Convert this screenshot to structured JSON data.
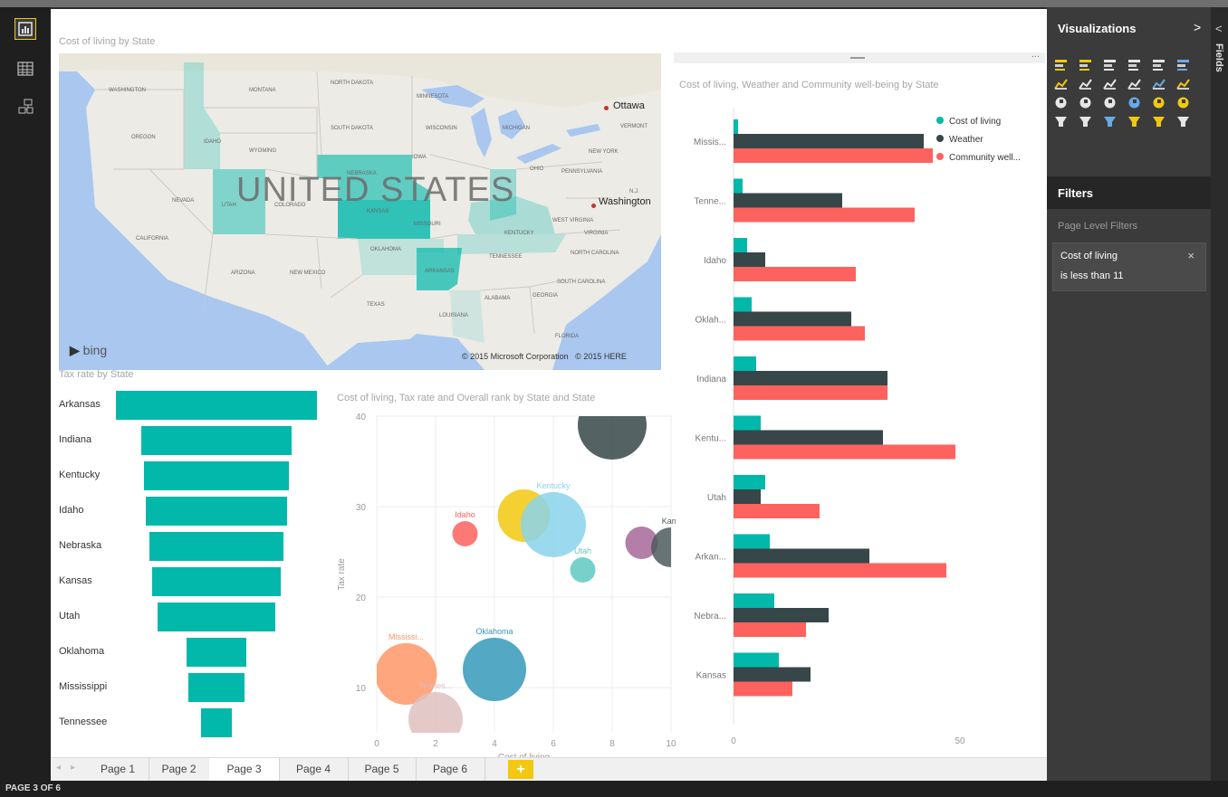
{
  "rail": {
    "items": [
      {
        "name": "report-view-icon"
      },
      {
        "name": "data-view-icon"
      },
      {
        "name": "relationships-view-icon"
      }
    ]
  },
  "map_visual": {
    "title": "Cost of living by State",
    "overlay_text": "UNITED STATES",
    "bing_label": "bing",
    "copyright": "© 2015 Microsoft Corporation   © 2015 HERE",
    "cities": [
      "Ottawa",
      "Washington"
    ],
    "state_labels": [
      {
        "text": "WASHINGTON"
      },
      {
        "text": "MONTANA"
      },
      {
        "text": "NORTH DAKOTA"
      },
      {
        "text": "MINNESOTA"
      },
      {
        "text": "OREGON"
      },
      {
        "text": "IDAHO"
      },
      {
        "text": "SOUTH DAKOTA"
      },
      {
        "text": "WISCONSIN"
      },
      {
        "text": "MICHIGAN"
      },
      {
        "text": "VERMONT"
      },
      {
        "text": "WYOMING"
      },
      {
        "text": "IOWA"
      },
      {
        "text": "NEW YORK"
      },
      {
        "text": "NEBRASKA"
      },
      {
        "text": "OHIO"
      },
      {
        "text": "PENNSYLVANIA"
      },
      {
        "text": "NEVADA"
      },
      {
        "text": "UTAH"
      },
      {
        "text": "COLORADO"
      },
      {
        "text": "KANSAS"
      },
      {
        "text": "MISSOURI"
      },
      {
        "text": "KENTUCKY"
      },
      {
        "text": "WEST VIRGINIA"
      },
      {
        "text": "VIRGINIA"
      },
      {
        "text": "CALIFORNIA"
      },
      {
        "text": "OKLAHOMA"
      },
      {
        "text": "TENNESSEE"
      },
      {
        "text": "NORTH CAROLINA"
      },
      {
        "text": "ARIZONA"
      },
      {
        "text": "NEW MEXICO"
      },
      {
        "text": "ARKANSAS"
      },
      {
        "text": "SOUTH CAROLINA"
      },
      {
        "text": "TEXAS"
      },
      {
        "text": "ALABAMA"
      },
      {
        "text": "GEORGIA"
      },
      {
        "text": "LOUISIANA"
      },
      {
        "text": "FLORIDA"
      },
      {
        "text": "N.J."
      }
    ],
    "highlight_color": "#01b8aa"
  },
  "funnel_visual": {
    "title": "Tax rate by State",
    "color": "#01b8aa"
  },
  "clustered_bar_visual": {
    "title": "Cost of living, Weather and Community well-being by State",
    "more_label": "...",
    "legend": [
      {
        "label": "Cost of living",
        "color": "#01b8aa"
      },
      {
        "label": "Weather",
        "color": "#374649"
      },
      {
        "label": "Community well...",
        "color": "#fd625e"
      }
    ]
  },
  "scatter_visual": {
    "title": "Cost of living, Tax rate and Overall rank by State and State"
  },
  "chart_data": [
    {
      "type": "bar",
      "title": "Tax rate by State",
      "categories": [
        "Arkansas",
        "Indiana",
        "Kentucky",
        "Idaho",
        "Nebraska",
        "Kansas",
        "Utah",
        "Oklahoma",
        "Mississippi",
        "Tennessee"
      ],
      "values": [
        100,
        75,
        72,
        70,
        67,
        64,
        59,
        30,
        28,
        15
      ],
      "note_type": "funnel"
    },
    {
      "type": "bar",
      "title": "Cost of living, Weather and Community well-being by State",
      "categories": [
        "Missis...",
        "Tenne...",
        "Idaho",
        "Oklah...",
        "Indiana",
        "Kentu...",
        "Utah",
        "Arkan...",
        "Nebra...",
        "Kansas"
      ],
      "series": [
        {
          "name": "Cost of living",
          "color": "#01b8aa",
          "values": [
            1,
            2,
            3,
            4,
            5,
            6,
            7,
            8,
            9,
            10
          ]
        },
        {
          "name": "Weather",
          "color": "#374649",
          "values": [
            42,
            24,
            7,
            26,
            34,
            33,
            6,
            30,
            21,
            17
          ]
        },
        {
          "name": "Community well...",
          "color": "#fd625e",
          "values": [
            44,
            40,
            27,
            29,
            34,
            49,
            19,
            47,
            16,
            13
          ]
        }
      ],
      "xlim": [
        0,
        60
      ],
      "xticks": [
        "0",
        "50"
      ],
      "orientation": "horizontal"
    },
    {
      "type": "scatter",
      "title": "Cost of living, Tax rate and Overall rank by State and State",
      "xlabel": "Cost of living",
      "ylabel": "Tax rate",
      "xlim": [
        0,
        10
      ],
      "ylim": [
        5,
        40
      ],
      "xticks": [
        "0",
        "2",
        "4",
        "6",
        "8",
        "10"
      ],
      "yticks": [
        "10",
        "20",
        "30",
        "40"
      ],
      "points": [
        {
          "label": "Mississi...",
          "x": 1,
          "y": 11.5,
          "size": 34,
          "color": "#fe9666"
        },
        {
          "label": "Tennes...",
          "x": 2,
          "y": 6.5,
          "size": 30,
          "color": "#dfbfbf"
        },
        {
          "label": "Idaho",
          "x": 3,
          "y": 27,
          "size": 14,
          "color": "#fd625e"
        },
        {
          "label": "Oklahoma",
          "x": 4,
          "y": 12,
          "size": 35,
          "color": "#3599b8"
        },
        {
          "label": "",
          "x": 5,
          "y": 29,
          "size": 29,
          "color": "#f2c80f"
        },
        {
          "label": "Kentucky",
          "x": 6,
          "y": 28,
          "size": 36,
          "color": "#8ad4eb"
        },
        {
          "label": "Utah",
          "x": 7,
          "y": 23,
          "size": 14,
          "color": "#5fc9c1"
        },
        {
          "label": "",
          "x": 8,
          "y": 39,
          "size": 38,
          "color": "#374649"
        },
        {
          "label": "",
          "x": 9,
          "y": 26,
          "size": 18,
          "color": "#a66999"
        },
        {
          "label": "Kans",
          "x": 10,
          "y": 25.5,
          "size": 22,
          "color": "#4e5a5d"
        }
      ]
    }
  ],
  "tabs": {
    "nav_left": "◂",
    "nav_right": "▸",
    "items": [
      {
        "label": "Page 1",
        "active": false
      },
      {
        "label": "Page 2",
        "active": false
      },
      {
        "label": "Page 3",
        "active": true
      },
      {
        "label": "Page 4",
        "active": false
      },
      {
        "label": "Page 5",
        "active": false
      },
      {
        "label": "Page 6",
        "active": false
      }
    ],
    "add_label": "+"
  },
  "visualizations_pane": {
    "title": "Visualizations",
    "collapse": ">",
    "icons": [
      "stacked-bar-chart-icon",
      "stacked-column-chart-icon",
      "clustered-bar-chart-icon",
      "clustered-column-chart-icon",
      "100-percent-bar-chart-icon",
      "100-percent-column-chart-icon",
      "line-chart-icon",
      "area-chart-icon",
      "line-and-column-chart-icon",
      "line-and-stacked-column-chart-icon",
      "waterfall-chart-icon",
      "scatter-chart-icon",
      "pie-chart-icon",
      "treemap-icon",
      "map-icon",
      "table-icon",
      "matrix-icon",
      "filled-map-icon",
      "funnel-icon",
      "gauge-icon",
      "card-icon",
      "multi-row-card-icon",
      "slicer-icon",
      "donut-chart-icon"
    ]
  },
  "filters_pane": {
    "title": "Filters",
    "section": "Page Level Filters",
    "card": {
      "field": "Cost of living",
      "condition": "is less than 11",
      "remove": "×"
    }
  },
  "fields_strip": {
    "label": "Fields",
    "arrow": "<"
  },
  "status": {
    "text": "PAGE 3 OF 6"
  }
}
